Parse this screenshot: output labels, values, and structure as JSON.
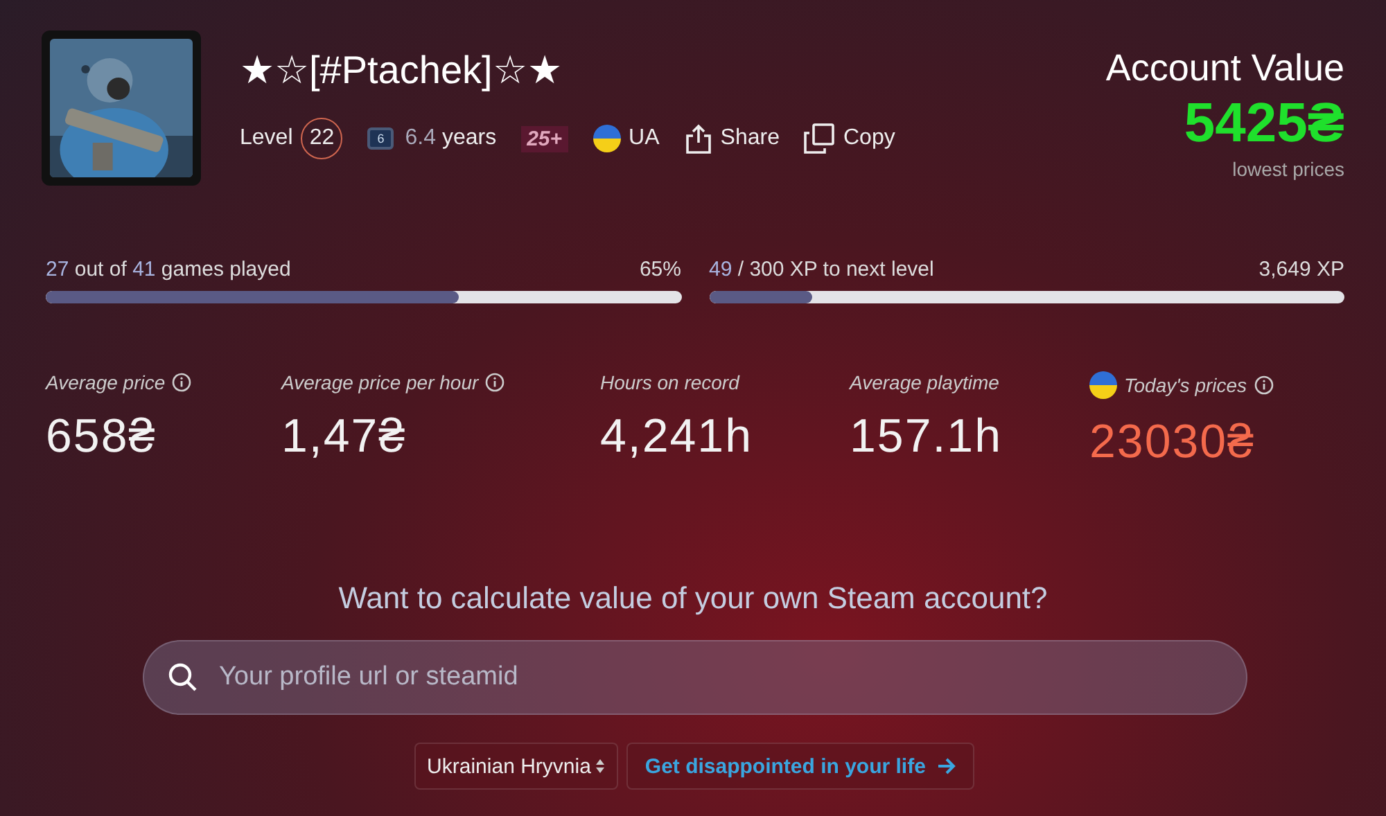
{
  "profile": {
    "name": "★☆[#Ptachek]☆★",
    "level_label": "Level",
    "level": "22",
    "years_badge": "6",
    "years_value": "6.4",
    "years_unit": "years",
    "age_badge": "25+",
    "country": "UA",
    "share": "Share",
    "copy": "Copy"
  },
  "account_value": {
    "title": "Account Value",
    "value": "5425₴",
    "note": "lowest prices"
  },
  "progress": [
    {
      "text": "**27** out of **41** games played",
      "reading": "65%",
      "level": 0.65
    },
    {
      "text": "**49** / 300 XP to next level",
      "reading": "3,649 XP",
      "level": 0.163
    }
  ],
  "stats": [
    {
      "kind": "plain",
      "label": "Average price",
      "info": true,
      "value": "658₴"
    },
    {
      "kind": "plain",
      "label": "Average price per hour",
      "info": true,
      "value": "1,47₴"
    },
    {
      "kind": "plain",
      "label": "Hours on record",
      "info": false,
      "value": "4,241h"
    },
    {
      "kind": "plain",
      "label": "Average playtime",
      "info": false,
      "value": "157.1h"
    },
    {
      "kind": "local",
      "label": "Today's prices",
      "info": true,
      "value": "23030₴"
    }
  ],
  "prompt": "Want to calculate value of your own Steam account?",
  "search": {
    "placeholder": "Your profile url or steamid"
  },
  "currency": "Ukrainian Hryvnia",
  "cta": "Get disappointed in your life"
}
